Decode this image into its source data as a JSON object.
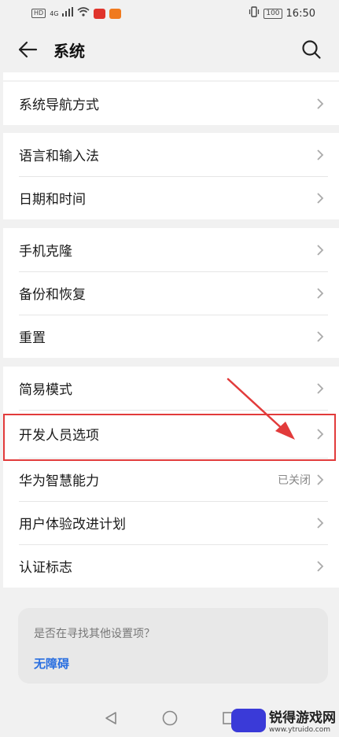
{
  "status_bar": {
    "hd_tag": "HD",
    "signal_tag": "4G",
    "battery": "100",
    "time": "16:50"
  },
  "header": {
    "title": "系统",
    "back_icon": "arrow-left-icon",
    "search_icon": "search-icon"
  },
  "groups": [
    {
      "items": [
        {
          "label": "系统导航方式"
        }
      ]
    },
    {
      "items": [
        {
          "label": "语言和输入法"
        },
        {
          "label": "日期和时间"
        }
      ]
    },
    {
      "items": [
        {
          "label": "手机克隆"
        },
        {
          "label": "备份和恢复"
        },
        {
          "label": "重置"
        }
      ]
    },
    {
      "items": [
        {
          "label": "简易模式"
        },
        {
          "label": "开发人员选项"
        },
        {
          "label": "华为智慧能力",
          "value": "已关闭"
        },
        {
          "label": "用户体验改进计划"
        },
        {
          "label": "认证标志"
        }
      ]
    }
  ],
  "suggestion": {
    "question": "是否在寻找其他设置项？",
    "link": "无障碍"
  },
  "watermark": {
    "title": "锐得游戏网",
    "url": "www.ytruido.com"
  },
  "colors": {
    "highlight": "#e23b3b",
    "link": "#2a6fe0"
  }
}
